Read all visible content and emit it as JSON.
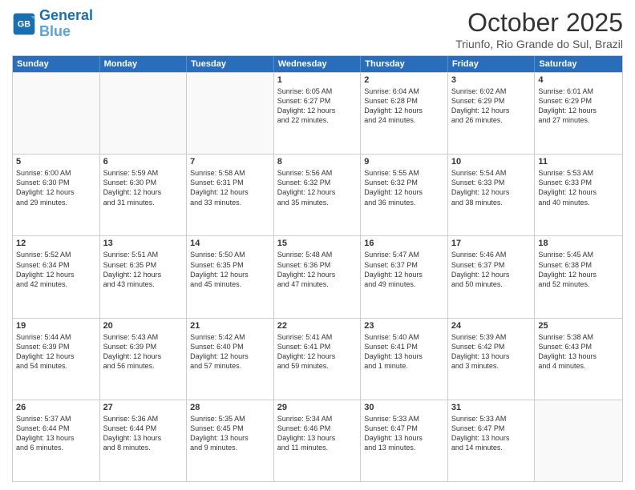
{
  "logo": {
    "line1": "General",
    "line2": "Blue"
  },
  "header": {
    "month": "October 2025",
    "location": "Triunfo, Rio Grande do Sul, Brazil"
  },
  "weekdays": [
    "Sunday",
    "Monday",
    "Tuesday",
    "Wednesday",
    "Thursday",
    "Friday",
    "Saturday"
  ],
  "rows": [
    [
      {
        "day": "",
        "info": ""
      },
      {
        "day": "",
        "info": ""
      },
      {
        "day": "",
        "info": ""
      },
      {
        "day": "1",
        "info": "Sunrise: 6:05 AM\nSunset: 6:27 PM\nDaylight: 12 hours\nand 22 minutes."
      },
      {
        "day": "2",
        "info": "Sunrise: 6:04 AM\nSunset: 6:28 PM\nDaylight: 12 hours\nand 24 minutes."
      },
      {
        "day": "3",
        "info": "Sunrise: 6:02 AM\nSunset: 6:29 PM\nDaylight: 12 hours\nand 26 minutes."
      },
      {
        "day": "4",
        "info": "Sunrise: 6:01 AM\nSunset: 6:29 PM\nDaylight: 12 hours\nand 27 minutes."
      }
    ],
    [
      {
        "day": "5",
        "info": "Sunrise: 6:00 AM\nSunset: 6:30 PM\nDaylight: 12 hours\nand 29 minutes."
      },
      {
        "day": "6",
        "info": "Sunrise: 5:59 AM\nSunset: 6:30 PM\nDaylight: 12 hours\nand 31 minutes."
      },
      {
        "day": "7",
        "info": "Sunrise: 5:58 AM\nSunset: 6:31 PM\nDaylight: 12 hours\nand 33 minutes."
      },
      {
        "day": "8",
        "info": "Sunrise: 5:56 AM\nSunset: 6:32 PM\nDaylight: 12 hours\nand 35 minutes."
      },
      {
        "day": "9",
        "info": "Sunrise: 5:55 AM\nSunset: 6:32 PM\nDaylight: 12 hours\nand 36 minutes."
      },
      {
        "day": "10",
        "info": "Sunrise: 5:54 AM\nSunset: 6:33 PM\nDaylight: 12 hours\nand 38 minutes."
      },
      {
        "day": "11",
        "info": "Sunrise: 5:53 AM\nSunset: 6:33 PM\nDaylight: 12 hours\nand 40 minutes."
      }
    ],
    [
      {
        "day": "12",
        "info": "Sunrise: 5:52 AM\nSunset: 6:34 PM\nDaylight: 12 hours\nand 42 minutes."
      },
      {
        "day": "13",
        "info": "Sunrise: 5:51 AM\nSunset: 6:35 PM\nDaylight: 12 hours\nand 43 minutes."
      },
      {
        "day": "14",
        "info": "Sunrise: 5:50 AM\nSunset: 6:35 PM\nDaylight: 12 hours\nand 45 minutes."
      },
      {
        "day": "15",
        "info": "Sunrise: 5:48 AM\nSunset: 6:36 PM\nDaylight: 12 hours\nand 47 minutes."
      },
      {
        "day": "16",
        "info": "Sunrise: 5:47 AM\nSunset: 6:37 PM\nDaylight: 12 hours\nand 49 minutes."
      },
      {
        "day": "17",
        "info": "Sunrise: 5:46 AM\nSunset: 6:37 PM\nDaylight: 12 hours\nand 50 minutes."
      },
      {
        "day": "18",
        "info": "Sunrise: 5:45 AM\nSunset: 6:38 PM\nDaylight: 12 hours\nand 52 minutes."
      }
    ],
    [
      {
        "day": "19",
        "info": "Sunrise: 5:44 AM\nSunset: 6:39 PM\nDaylight: 12 hours\nand 54 minutes."
      },
      {
        "day": "20",
        "info": "Sunrise: 5:43 AM\nSunset: 6:39 PM\nDaylight: 12 hours\nand 56 minutes."
      },
      {
        "day": "21",
        "info": "Sunrise: 5:42 AM\nSunset: 6:40 PM\nDaylight: 12 hours\nand 57 minutes."
      },
      {
        "day": "22",
        "info": "Sunrise: 5:41 AM\nSunset: 6:41 PM\nDaylight: 12 hours\nand 59 minutes."
      },
      {
        "day": "23",
        "info": "Sunrise: 5:40 AM\nSunset: 6:41 PM\nDaylight: 13 hours\nand 1 minute."
      },
      {
        "day": "24",
        "info": "Sunrise: 5:39 AM\nSunset: 6:42 PM\nDaylight: 13 hours\nand 3 minutes."
      },
      {
        "day": "25",
        "info": "Sunrise: 5:38 AM\nSunset: 6:43 PM\nDaylight: 13 hours\nand 4 minutes."
      }
    ],
    [
      {
        "day": "26",
        "info": "Sunrise: 5:37 AM\nSunset: 6:44 PM\nDaylight: 13 hours\nand 6 minutes."
      },
      {
        "day": "27",
        "info": "Sunrise: 5:36 AM\nSunset: 6:44 PM\nDaylight: 13 hours\nand 8 minutes."
      },
      {
        "day": "28",
        "info": "Sunrise: 5:35 AM\nSunset: 6:45 PM\nDaylight: 13 hours\nand 9 minutes."
      },
      {
        "day": "29",
        "info": "Sunrise: 5:34 AM\nSunset: 6:46 PM\nDaylight: 13 hours\nand 11 minutes."
      },
      {
        "day": "30",
        "info": "Sunrise: 5:33 AM\nSunset: 6:47 PM\nDaylight: 13 hours\nand 13 minutes."
      },
      {
        "day": "31",
        "info": "Sunrise: 5:33 AM\nSunset: 6:47 PM\nDaylight: 13 hours\nand 14 minutes."
      },
      {
        "day": "",
        "info": ""
      }
    ]
  ]
}
